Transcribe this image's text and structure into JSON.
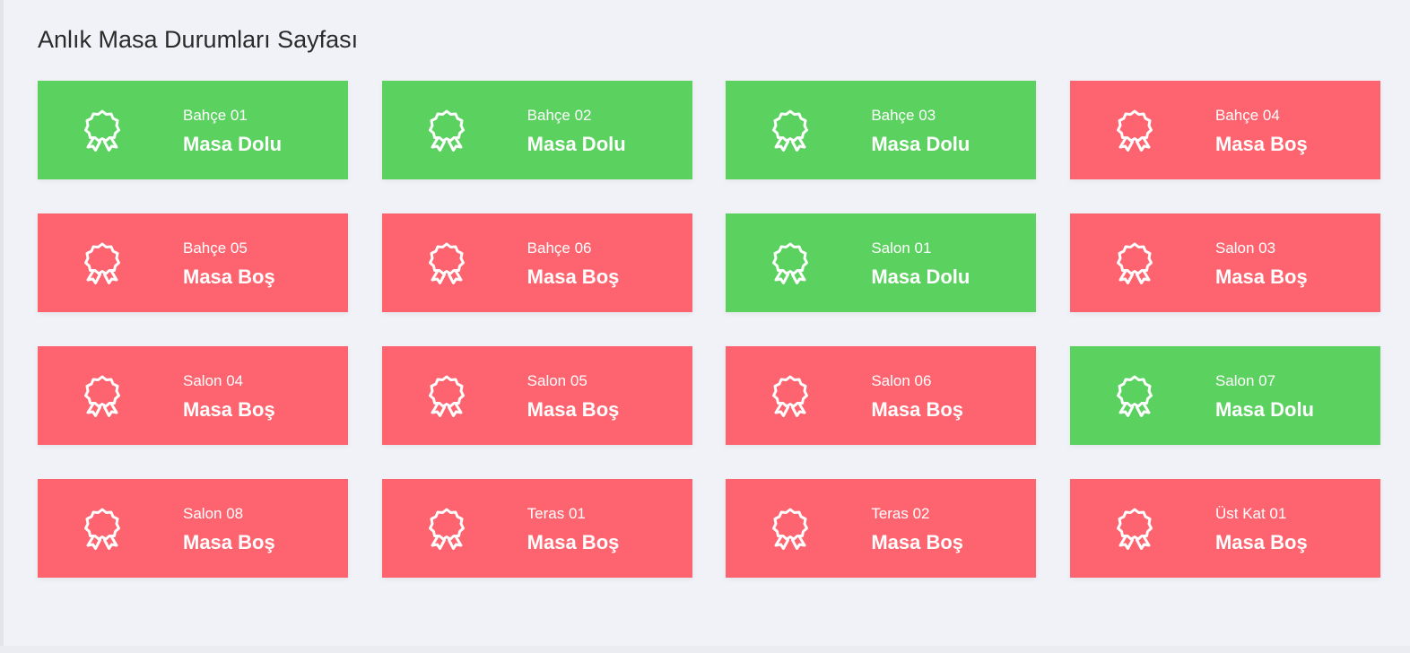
{
  "page_title": "Anlık Masa Durumları Sayfası",
  "colors": {
    "full": "#5bd160",
    "empty": "#fe646f",
    "background": "#f1f2f7",
    "text_on_card": "#ffffff"
  },
  "card_icon": "award-ribbon-icon",
  "tables": [
    {
      "name": "Bahçe 01",
      "status": "Masa Dolu",
      "state": "full"
    },
    {
      "name": "Bahçe 02",
      "status": "Masa Dolu",
      "state": "full"
    },
    {
      "name": "Bahçe 03",
      "status": "Masa Dolu",
      "state": "full"
    },
    {
      "name": "Bahçe 04",
      "status": "Masa Boş",
      "state": "empty"
    },
    {
      "name": "Bahçe 05",
      "status": "Masa Boş",
      "state": "empty"
    },
    {
      "name": "Bahçe 06",
      "status": "Masa Boş",
      "state": "empty"
    },
    {
      "name": "Salon 01",
      "status": "Masa Dolu",
      "state": "full"
    },
    {
      "name": "Salon 03",
      "status": "Masa Boş",
      "state": "empty"
    },
    {
      "name": "Salon 04",
      "status": "Masa Boş",
      "state": "empty"
    },
    {
      "name": "Salon 05",
      "status": "Masa Boş",
      "state": "empty"
    },
    {
      "name": "Salon 06",
      "status": "Masa Boş",
      "state": "empty"
    },
    {
      "name": "Salon 07",
      "status": "Masa Dolu",
      "state": "full"
    },
    {
      "name": "Salon 08",
      "status": "Masa Boş",
      "state": "empty"
    },
    {
      "name": "Teras 01",
      "status": "Masa Boş",
      "state": "empty"
    },
    {
      "name": "Teras 02",
      "status": "Masa Boş",
      "state": "empty"
    },
    {
      "name": "Üst Kat 01",
      "status": "Masa Boş",
      "state": "empty"
    }
  ]
}
